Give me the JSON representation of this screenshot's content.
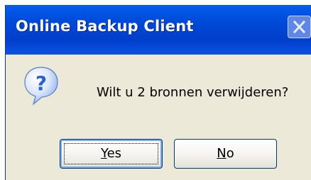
{
  "window": {
    "title": "Online Backup Client",
    "close_icon": "close-icon"
  },
  "dialog": {
    "icon": "question-icon",
    "message": "Wilt u 2 bronnen verwijderen?"
  },
  "buttons": {
    "yes": {
      "mnemonic": "Y",
      "rest": "es"
    },
    "no": {
      "mnemonic": "N",
      "rest": "o"
    }
  },
  "colors": {
    "titlebar": "#0049D8",
    "dialog_background": "#ECE9D8",
    "button_border": "#003C74",
    "icon_blue": "#2C5FD0"
  }
}
